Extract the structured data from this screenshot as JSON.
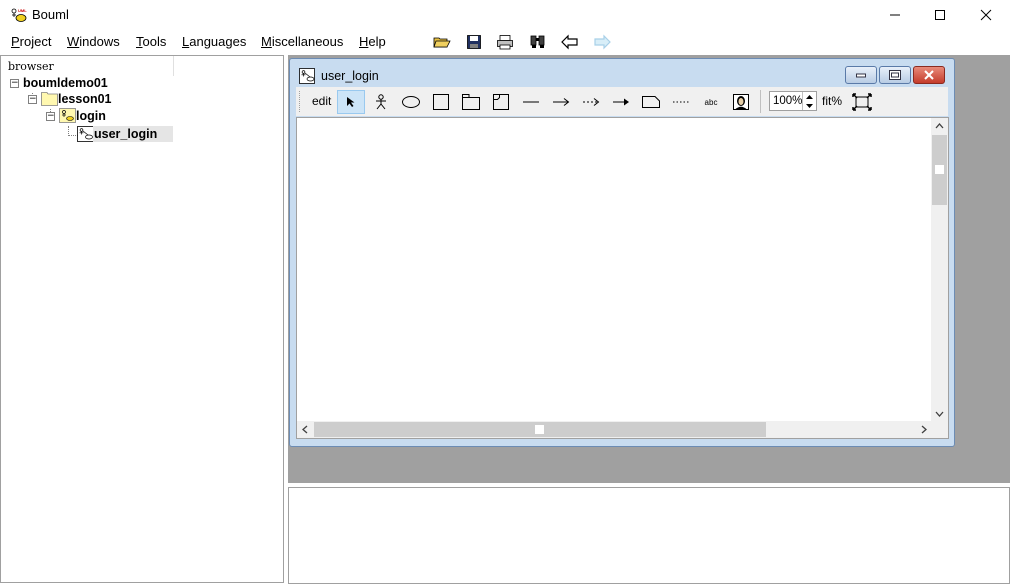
{
  "app": {
    "title": "Bouml",
    "icon": "bouml-app-icon"
  },
  "menu": [
    {
      "label": "Project",
      "key": "P",
      "rest": "roject"
    },
    {
      "label": "Windows",
      "key": "W",
      "rest": "indows"
    },
    {
      "label": "Tools",
      "key": "T",
      "rest": "ools"
    },
    {
      "label": "Languages",
      "key": "L",
      "rest": "anguages"
    },
    {
      "label": "Miscellaneous",
      "key": "M",
      "rest": "iscellaneous"
    },
    {
      "label": "Help",
      "key": "H",
      "rest": "elp"
    }
  ],
  "toolbar_icons": [
    "open-folder-icon",
    "save-icon",
    "print-icon",
    "search-icon",
    "back-arrow-icon",
    "forward-arrow-icon"
  ],
  "browser": {
    "header": "browser",
    "tree": [
      {
        "label": "boumldemo01",
        "icon": "project-icon"
      },
      {
        "label": "lesson01",
        "icon": "package-folder-icon"
      },
      {
        "label": "login",
        "icon": "use-case-view-icon"
      },
      {
        "label": "user_login",
        "icon": "use-case-diagram-icon"
      }
    ]
  },
  "diagram": {
    "title": "user_login",
    "edit_label": "edit",
    "zoom": "100%",
    "fit_label": "fit%",
    "text_tool_label": "abc",
    "tools": [
      "select-arrow-icon",
      "actor-icon",
      "use-case-ellipse-icon",
      "class-rect-icon",
      "package-icon",
      "fragment-icon",
      "association-line-icon",
      "directed-arrow-icon",
      "dependency-arrow-icon",
      "generalization-arrow-icon",
      "note-icon",
      "anchor-dotted-icon",
      "text-tool",
      "image-icon"
    ]
  },
  "colors": {
    "mdi_bg": "#a0a0a0",
    "window_frame": "#c8dcf0",
    "close_red": "#c43c2c"
  }
}
